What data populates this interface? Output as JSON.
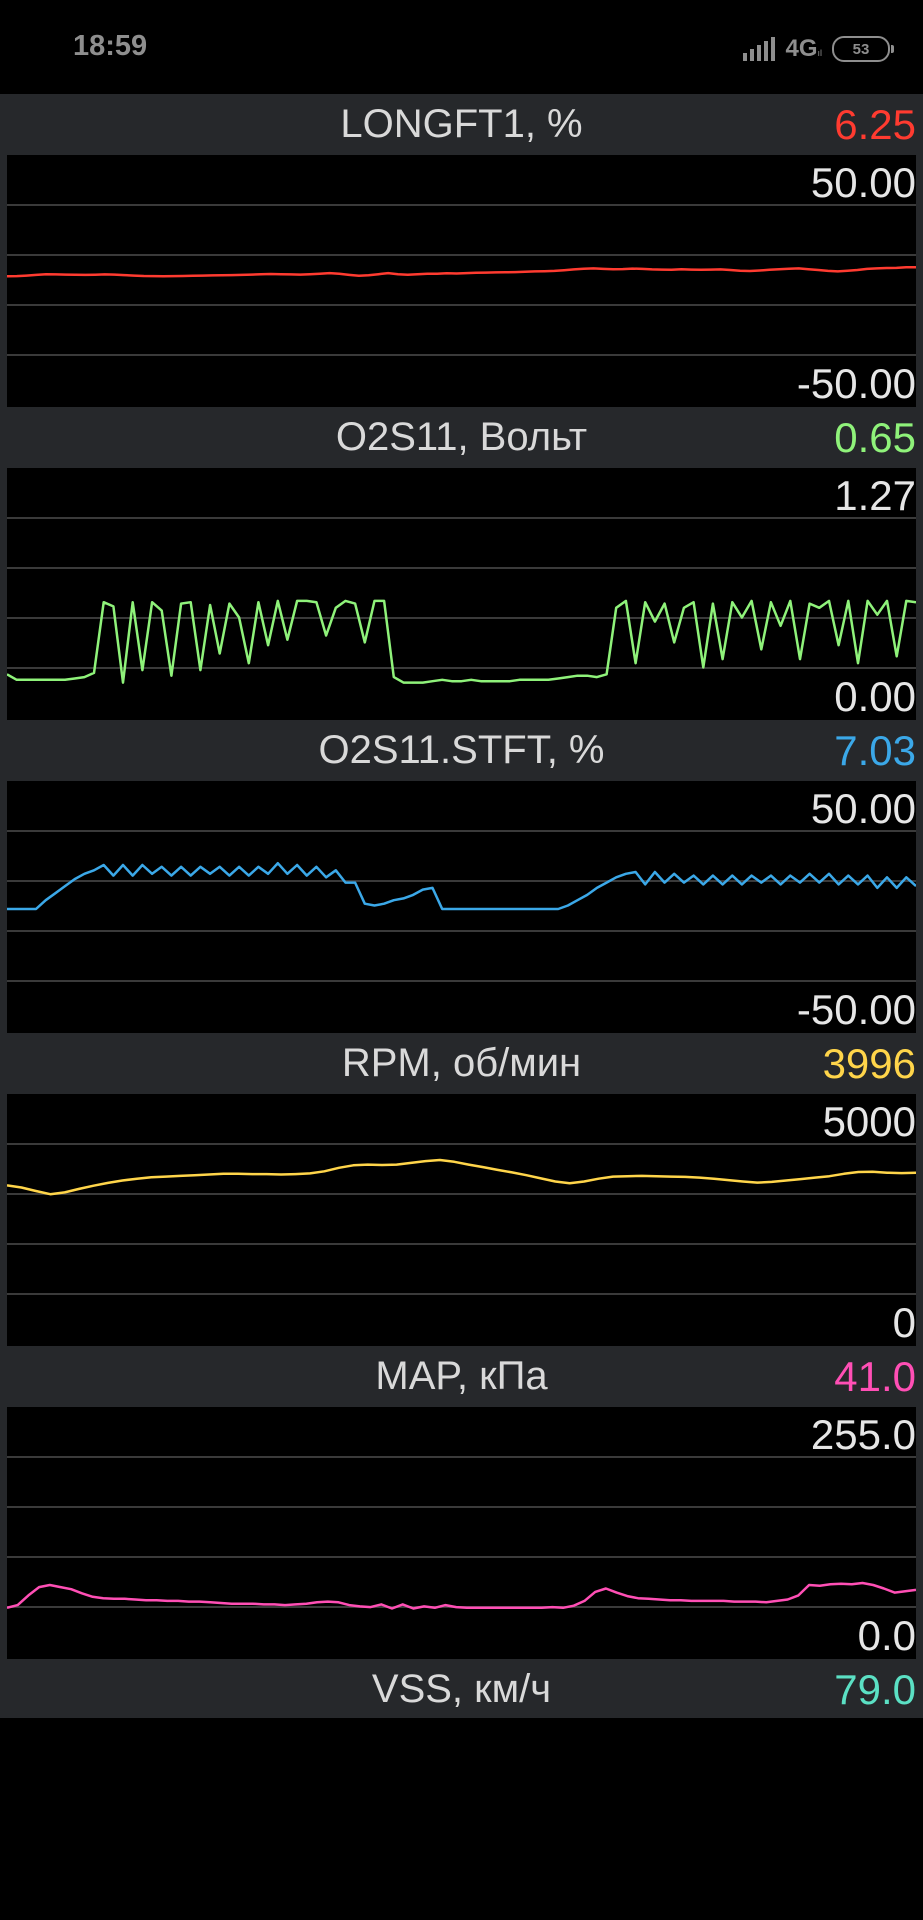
{
  "status_bar": {
    "time": "18:59",
    "network": "4G",
    "network_sub": "ıl",
    "battery": "53"
  },
  "panels": [
    {
      "id": "longft1",
      "title": "LONGFT1, %",
      "value": "6.25",
      "color": "#ff3b30",
      "ymax_label": "50.00",
      "ymin_label": "-50.00",
      "chart_data": {
        "type": "line",
        "ylim": [
          -50,
          50
        ],
        "values": [
          3.8,
          3.9,
          4.2,
          4.6,
          5.0,
          4.9,
          4.8,
          4.7,
          4.6,
          4.7,
          4.9,
          4.8,
          4.5,
          4.2,
          4.0,
          3.9,
          3.8,
          3.9,
          4.0,
          4.1,
          4.2,
          4.3,
          4.4,
          4.5,
          4.6,
          4.8,
          5.0,
          5.1,
          5.0,
          4.9,
          4.8,
          5.0,
          5.3,
          5.6,
          5.2,
          4.6,
          4.1,
          4.4,
          5.0,
          5.6,
          5.0,
          4.7,
          5.0,
          5.2,
          5.3,
          5.5,
          5.4,
          5.6,
          5.8,
          5.9,
          6.0,
          6.1,
          6.2,
          6.4,
          6.6,
          6.7,
          6.9,
          7.3,
          7.7,
          8.1,
          8.3,
          8.0,
          7.8,
          7.9,
          8.2,
          8.0,
          7.7,
          7.6,
          7.5,
          7.8,
          7.6,
          7.5,
          7.6,
          7.7,
          7.4,
          7.0,
          6.8,
          7.1,
          7.5,
          7.8,
          8.1,
          8.3,
          7.8,
          7.4,
          6.9,
          6.6,
          7.0,
          7.4,
          8.0,
          8.3,
          8.5,
          8.6,
          8.9,
          9.0
        ]
      }
    },
    {
      "id": "o2s11",
      "title": "O2S11, Вольт",
      "value": "0.65",
      "color": "#8ff27a",
      "ymax_label": "1.27",
      "ymin_label": "0.00",
      "chart_data": {
        "type": "line",
        "ylim": [
          0,
          1.27
        ],
        "values": [
          0.07,
          0.03,
          0.03,
          0.03,
          0.03,
          0.03,
          0.03,
          0.04,
          0.05,
          0.08,
          0.59,
          0.56,
          0.01,
          0.59,
          0.1,
          0.59,
          0.53,
          0.06,
          0.58,
          0.59,
          0.1,
          0.57,
          0.22,
          0.58,
          0.48,
          0.15,
          0.59,
          0.28,
          0.6,
          0.32,
          0.6,
          0.6,
          0.59,
          0.35,
          0.55,
          0.6,
          0.58,
          0.3,
          0.6,
          0.6,
          0.05,
          0.01,
          0.01,
          0.01,
          0.02,
          0.03,
          0.02,
          0.02,
          0.03,
          0.02,
          0.02,
          0.02,
          0.02,
          0.03,
          0.03,
          0.03,
          0.03,
          0.04,
          0.05,
          0.06,
          0.06,
          0.05,
          0.07,
          0.55,
          0.6,
          0.15,
          0.59,
          0.45,
          0.58,
          0.3,
          0.55,
          0.59,
          0.12,
          0.58,
          0.18,
          0.59,
          0.48,
          0.6,
          0.25,
          0.59,
          0.42,
          0.6,
          0.18,
          0.58,
          0.55,
          0.6,
          0.28,
          0.6,
          0.15,
          0.6,
          0.5,
          0.6,
          0.2,
          0.6,
          0.59
        ]
      }
    },
    {
      "id": "stft",
      "title": "O2S11.STFT, %",
      "value": "7.03",
      "color": "#3ba8e8",
      "ymax_label": "50.00",
      "ymin_label": "-50.00",
      "chart_data": {
        "type": "line",
        "ylim": [
          -50,
          50
        ],
        "values": [
          0,
          0,
          0,
          0,
          5,
          9,
          13,
          17,
          20,
          22,
          25,
          19,
          25,
          19,
          25,
          20,
          24,
          19,
          24,
          19,
          24,
          20,
          24,
          19,
          24,
          19,
          24,
          20,
          26,
          20,
          25,
          19,
          24,
          18,
          22,
          15,
          15,
          3,
          2,
          3,
          5,
          6,
          8,
          11,
          12,
          0,
          0,
          0,
          0,
          0,
          0,
          0,
          0,
          0,
          0,
          0,
          0,
          0,
          2,
          5,
          8,
          12,
          15,
          18,
          20,
          21,
          14,
          21,
          15,
          20,
          15,
          19,
          14,
          19,
          14,
          19,
          14,
          19,
          15,
          19,
          14,
          19,
          15,
          20,
          15,
          20,
          14,
          19,
          14,
          19,
          12,
          18,
          12,
          18,
          13
        ]
      }
    },
    {
      "id": "rpm",
      "title": "RPM, об/мин",
      "value": "3996",
      "color": "#ffd54a",
      "ymax_label": "5000",
      "ymin_label": "0",
      "chart_data": {
        "type": "line",
        "ylim": [
          0,
          5000
        ],
        "values": [
          3540,
          3480,
          3380,
          3290,
          3340,
          3440,
          3530,
          3610,
          3680,
          3730,
          3770,
          3790,
          3810,
          3830,
          3850,
          3870,
          3870,
          3860,
          3860,
          3850,
          3860,
          3880,
          3940,
          4040,
          4110,
          4130,
          4120,
          4130,
          4180,
          4230,
          4260,
          4210,
          4130,
          4060,
          3980,
          3910,
          3830,
          3740,
          3650,
          3600,
          3650,
          3730,
          3790,
          3800,
          3810,
          3800,
          3790,
          3780,
          3760,
          3730,
          3690,
          3650,
          3620,
          3640,
          3680,
          3720,
          3760,
          3800,
          3870,
          3920,
          3930,
          3900,
          3890,
          3900
        ]
      }
    },
    {
      "id": "map",
      "title": "MAP, кПа",
      "value": "41.0",
      "color": "#ff4fb5",
      "ymax_label": "255.0",
      "ymin_label": "0.0",
      "chart_data": {
        "type": "line",
        "ylim": [
          0,
          255
        ],
        "values": [
          22,
          26,
          40,
          52,
          55,
          52,
          49,
          43,
          38,
          36,
          35,
          35,
          34,
          33,
          33,
          32,
          32,
          31,
          31,
          30,
          29,
          28,
          28,
          28,
          27,
          27,
          26,
          27,
          28,
          30,
          31,
          30,
          26,
          24,
          23,
          27,
          21,
          27,
          21,
          24,
          22,
          26,
          23,
          22,
          22,
          22,
          22,
          22,
          22,
          22,
          22,
          23,
          22,
          25,
          32,
          45,
          50,
          44,
          39,
          36,
          35,
          34,
          33,
          33,
          32,
          32,
          32,
          32,
          31,
          31,
          31,
          30,
          32,
          34,
          40,
          55,
          54,
          56,
          57,
          56,
          58,
          55,
          50,
          44,
          46,
          48
        ]
      }
    }
  ],
  "last_panel": {
    "title": "VSS, км/ч",
    "value": "79.0",
    "color": "#5be0c4"
  }
}
